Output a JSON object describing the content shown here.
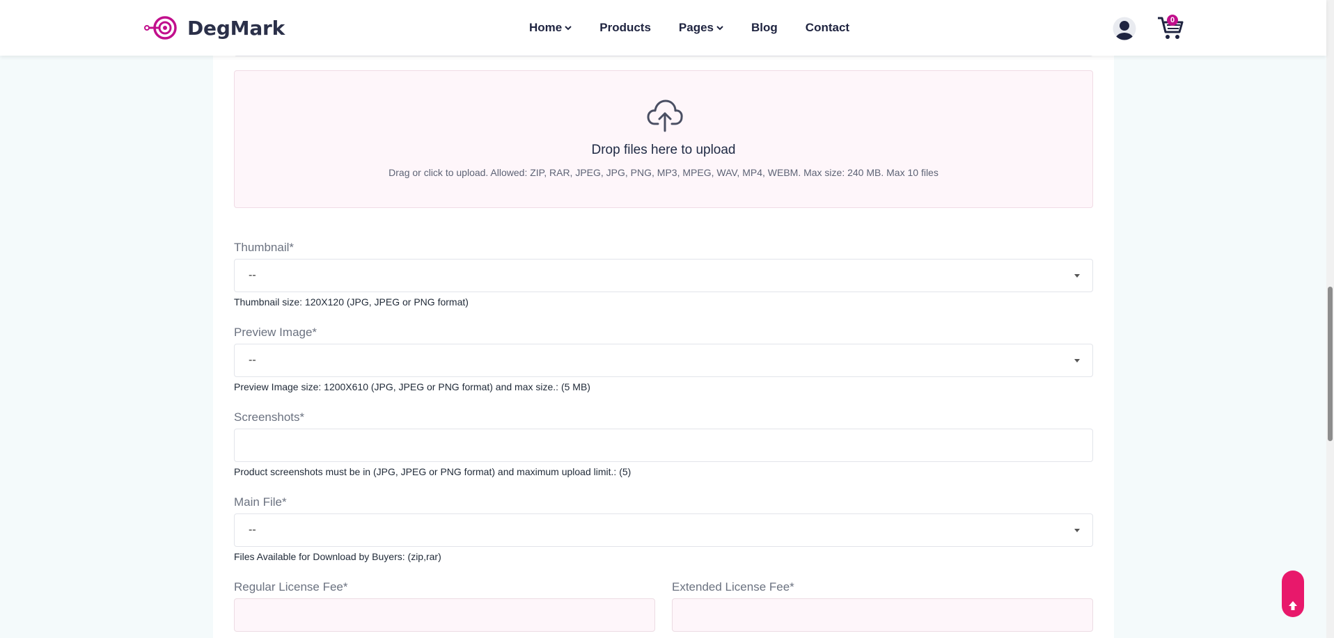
{
  "header": {
    "brand": "DegMark",
    "nav": [
      {
        "label": "Home",
        "dropdown": true
      },
      {
        "label": "Products",
        "dropdown": false
      },
      {
        "label": "Pages",
        "dropdown": true
      },
      {
        "label": "Blog",
        "dropdown": false
      },
      {
        "label": "Contact",
        "dropdown": false
      }
    ],
    "cart_count": "0"
  },
  "dropzone": {
    "title": "Drop files here to upload",
    "subtitle": "Drag or click to upload. Allowed: ZIP, RAR, JPEG, JPG, PNG, MP3, MPEG, WAV, MP4, WEBM. Max size: 240 MB. Max 10 files"
  },
  "form": {
    "thumbnail": {
      "label": "Thumbnail*",
      "value": "--",
      "hint": "Thumbnail size: 120X120 (JPG, JPEG or PNG format)"
    },
    "preview": {
      "label": "Preview Image*",
      "value": "--",
      "hint": "Preview Image size: 1200X610 (JPG, JPEG or PNG format) and max size.: (5 MB)"
    },
    "screenshots": {
      "label": "Screenshots*",
      "value": "",
      "hint": "Product screenshots must be in (JPG, JPEG or PNG format) and maximum upload limit.: (5)"
    },
    "main_file": {
      "label": "Main File*",
      "value": "--",
      "hint": "Files Available for Download by Buyers: (zip,rar)"
    },
    "regular_fee": {
      "label": "Regular License Fee*",
      "value": ""
    },
    "extended_fee": {
      "label": "Extended License Fee*",
      "value": ""
    }
  },
  "colors": {
    "accent": "#c10f8c",
    "back_to_top": "#e8186b",
    "dropzone_bg": "#fef6fa"
  }
}
